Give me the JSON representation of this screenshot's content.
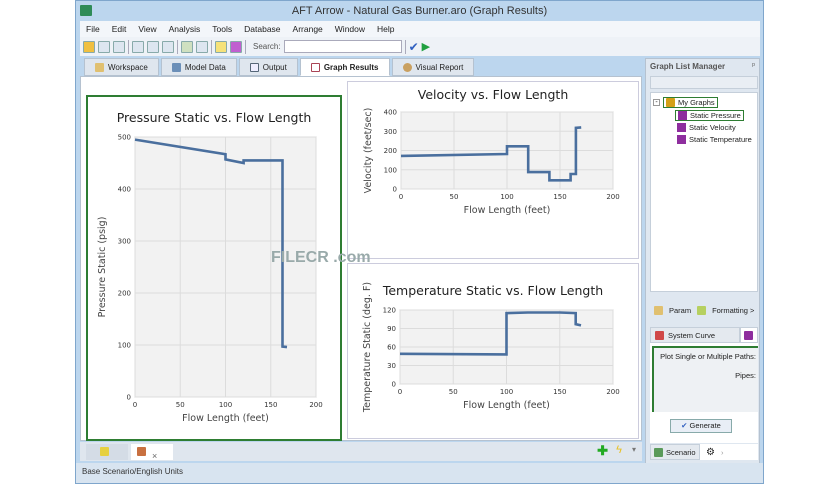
{
  "window": {
    "title": "AFT Arrow - Natural Gas Burner.aro (Graph Results)"
  },
  "menu": [
    "File",
    "Edit",
    "View",
    "Analysis",
    "Tools",
    "Database",
    "Arrange",
    "Window",
    "Help"
  ],
  "toolbar": {
    "search_label": "Search:",
    "search_value": ""
  },
  "tabs": [
    "Workspace",
    "Model Data",
    "Output",
    "Graph Results",
    "Visual Report"
  ],
  "active_tab": "Graph Results",
  "graph_list_manager": {
    "title": "Graph List Manager",
    "root": "My Graphs",
    "items": [
      "Static Pressure",
      "Static Velocity",
      "Static Temperature"
    ],
    "selected": "Static Pressure"
  },
  "side_panel": {
    "param_label": "Param",
    "formatting_label": "Formatting >",
    "system_curve_tab": "System Curve",
    "plot_paths_label": "Plot Single or Multiple Paths:",
    "pipes_label": "Pipes:",
    "generate_button": "Generate",
    "scenario_tab": "Scenario"
  },
  "status_bar": "Base Scenario/English Units",
  "watermark": "FILECR .com",
  "colors": {
    "series": "#4a6f9e",
    "active_border": "#2e7d32"
  },
  "chart_data": [
    {
      "type": "line",
      "title": "Pressure Static vs. Flow Length",
      "xlabel": "Flow Length (feet)",
      "ylabel": "Pressure Static (psig)",
      "xlim": [
        0,
        200
      ],
      "ylim": [
        0,
        500
      ],
      "xticks": [
        0,
        50,
        100,
        150,
        200
      ],
      "yticks": [
        0,
        100,
        200,
        300,
        400,
        500
      ],
      "grid": true,
      "x": [
        0,
        100,
        100,
        120,
        120,
        163,
        163,
        168
      ],
      "y": [
        495,
        467,
        457,
        450,
        455,
        455,
        97,
        96
      ]
    },
    {
      "type": "line",
      "title": "Velocity vs. Flow Length",
      "xlabel": "Flow Length (feet)",
      "ylabel": "Velocity (feet/sec)",
      "xlim": [
        0,
        200
      ],
      "ylim": [
        0,
        400
      ],
      "xticks": [
        0,
        50,
        100,
        150,
        200
      ],
      "yticks": [
        0,
        100,
        200,
        300,
        400
      ],
      "grid": true,
      "x": [
        0,
        100,
        100,
        120,
        120,
        140,
        140,
        160,
        160,
        165,
        165,
        170
      ],
      "y": [
        172,
        182,
        222,
        222,
        88,
        88,
        45,
        45,
        78,
        78,
        318,
        320
      ]
    },
    {
      "type": "line",
      "title": "Temperature Static vs. Flow Length",
      "xlabel": "Flow Length (feet)",
      "ylabel": "Temperature Static (deg. F)",
      "xlim": [
        0,
        200
      ],
      "ylim": [
        0,
        120
      ],
      "xticks": [
        0,
        50,
        100,
        150,
        200
      ],
      "yticks": [
        0,
        30,
        60,
        90,
        120
      ],
      "grid": true,
      "x": [
        0,
        100,
        100,
        120,
        150,
        165,
        165,
        170
      ],
      "y": [
        49,
        48,
        115,
        116,
        116,
        115,
        97,
        95
      ]
    }
  ]
}
